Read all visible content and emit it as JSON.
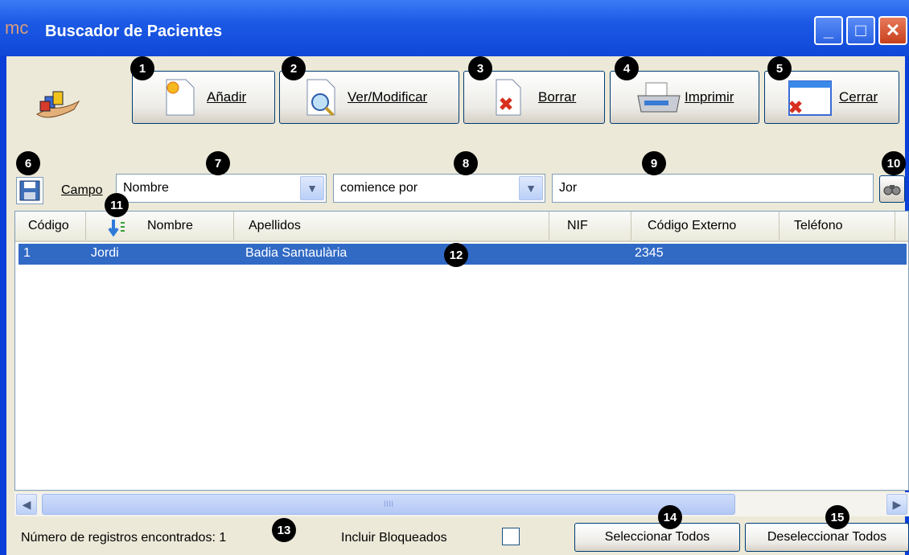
{
  "window": {
    "logo": "mc",
    "title": "Buscador de Pacientes",
    "controls": {
      "minimize": "_",
      "maximize": "□",
      "close": "✕"
    }
  },
  "toolbar": {
    "add_label": "Añadir",
    "view_label": "Ver/Modificar",
    "delete_label": "Borrar",
    "print_label": "Imprimir",
    "close_label": "Cerrar"
  },
  "filter": {
    "field_label": "Campo",
    "field_value": "Nombre",
    "condition_value": "comience por",
    "search_value": "Jor"
  },
  "grid": {
    "columns": [
      "Código",
      "Nombre",
      "Apellidos",
      "NIF",
      "Código Externo",
      "Teléfono"
    ],
    "rows": [
      {
        "codigo": "1",
        "nombre": "Jordi",
        "apellidos": "Badia Santaulària",
        "nif": "",
        "codigo_externo": "2345",
        "telefono": ""
      }
    ]
  },
  "scrollbar": {
    "grip": "IIII"
  },
  "footer": {
    "records_text": "Número de registros encontrados: 1",
    "include_blocked_label": "Incluir Bloqueados",
    "include_blocked_checked": false,
    "select_all_label": "Seleccionar Todos",
    "deselect_all_label": "Deseleccionar Todos"
  },
  "annotations": [
    "1",
    "2",
    "3",
    "4",
    "5",
    "6",
    "7",
    "8",
    "9",
    "10",
    "11",
    "12",
    "13",
    "14",
    "15"
  ],
  "colors": {
    "titlebar": "#0f47d6",
    "selection": "#316ac5",
    "client": "#ece9d8",
    "border": "#003c74"
  }
}
